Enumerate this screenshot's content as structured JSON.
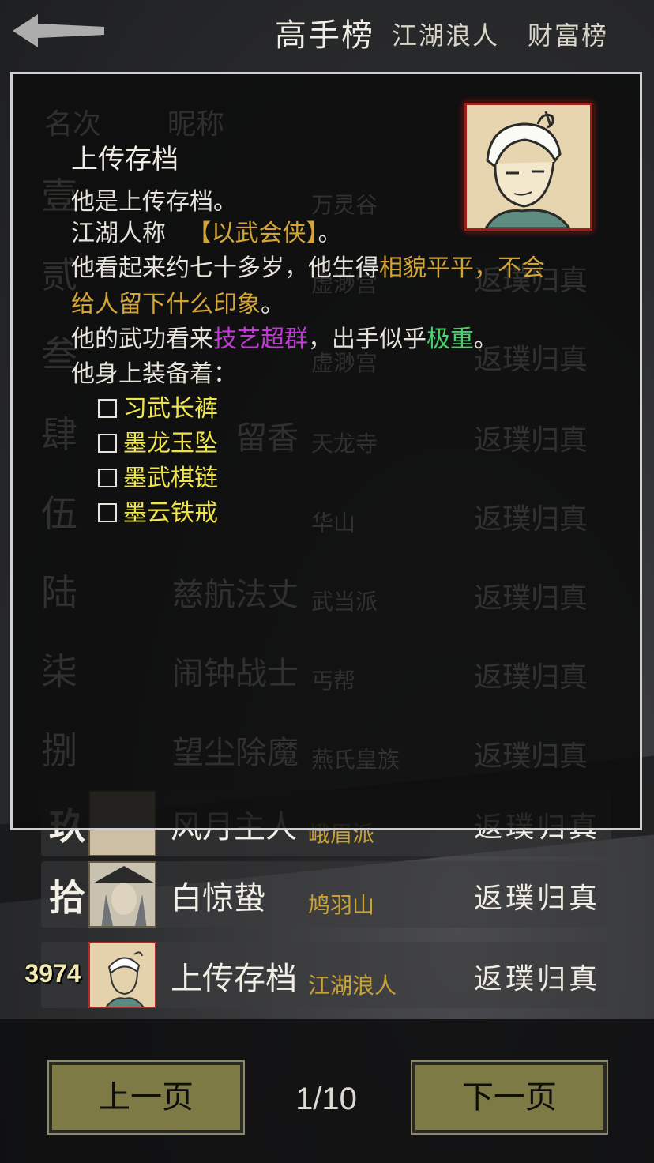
{
  "tabs": [
    "高手榜",
    "江湖浪人",
    "财富榜"
  ],
  "ghost_headers": {
    "rank": "名次",
    "nick": "昵称"
  },
  "rows": [
    {
      "rank": "玖",
      "nick": "风月主人",
      "sect": "峨眉派",
      "realm": "返璞归真"
    },
    {
      "rank": "拾",
      "nick": "白惊蛰",
      "sect": "鸠羽山",
      "realm": "返璞归真"
    },
    {
      "rank": "3974",
      "nick": "上传存档",
      "sect": "江湖浪人",
      "realm": "返璞归真"
    }
  ],
  "ghost_rows": [
    {
      "rank": "壹",
      "nick": "",
      "sect": "万灵谷",
      "realm": ""
    },
    {
      "rank": "贰",
      "nick": "",
      "sect": "虚渺宫",
      "realm": "返璞归真"
    },
    {
      "rank": "叁",
      "nick": "",
      "sect": "虚渺宫",
      "realm": "返璞归真"
    },
    {
      "rank": "肆",
      "nick": "留香",
      "sect": "天龙寺",
      "realm": "返璞归真"
    },
    {
      "rank": "伍",
      "nick": "",
      "sect": "华山",
      "realm": "返璞归真"
    },
    {
      "rank": "陆",
      "nick": "慈航法丈",
      "sect": "武当派",
      "realm": "返璞归真"
    },
    {
      "rank": "柒",
      "nick": "闹钟战士",
      "sect": "丐帮",
      "realm": "返璞归真"
    },
    {
      "rank": "捌",
      "nick": "望尘除魔",
      "sect": "燕氏皇族",
      "realm": "返璞归真"
    }
  ],
  "popup": {
    "name": "上传存档",
    "line1": "他是上传存档。",
    "line2_prefix": "江湖人称",
    "line2_title": "【以武会侠】",
    "line2_suffix": "。",
    "line3_prefix": "他看起来约七十多岁，他生得",
    "line3_hl": "相貌平平，不会",
    "line4_hl": "给人留下什么印象",
    "line4_suffix": "。",
    "line5_prefix": "他的武功看来",
    "line5_skill": "技艺超群",
    "line5_mid": "，出手似乎",
    "line5_power": "极重",
    "line5_suffix": "。",
    "line6": "他身上装备着：",
    "equipment": [
      "习武长裤",
      "墨龙玉坠",
      "墨武棋链",
      "墨云铁戒"
    ]
  },
  "pagination": {
    "prev": "上一页",
    "page": "1/10",
    "next": "下一页"
  }
}
